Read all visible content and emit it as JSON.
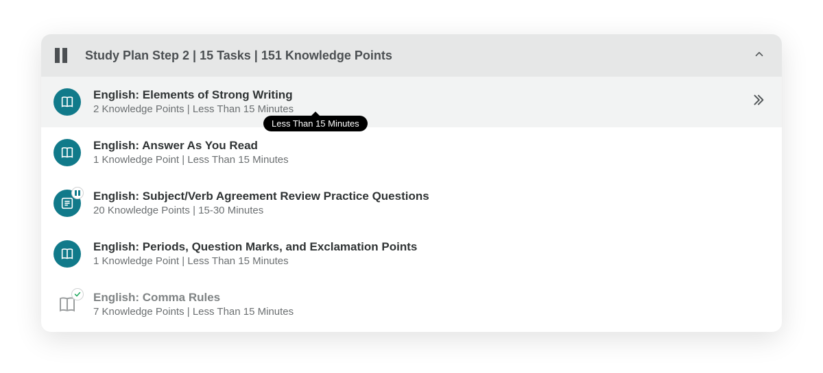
{
  "header": {
    "title": "Study Plan Step 2 | 15 Tasks | 151 Knowledge Points"
  },
  "tooltip": "Less Than 15 Minutes",
  "tasks": [
    {
      "title": "English: Elements of Strong Writing",
      "meta": "2 Knowledge Points | Less Than 15 Minutes",
      "icon": "book",
      "selected": true,
      "faded": false,
      "badge": null,
      "expand": true
    },
    {
      "title": "English: Answer As You Read",
      "meta": "1 Knowledge Point | Less Than 15 Minutes",
      "icon": "book",
      "selected": false,
      "faded": false,
      "badge": null,
      "expand": false
    },
    {
      "title": "English: Subject/Verb Agreement Review Practice Questions",
      "meta": "20 Knowledge Points | 15-30 Minutes",
      "icon": "list",
      "selected": false,
      "faded": false,
      "badge": "pause",
      "expand": false
    },
    {
      "title": "English: Periods, Question Marks, and Exclamation Points",
      "meta": "1 Knowledge Point | Less Than 15 Minutes",
      "icon": "book",
      "selected": false,
      "faded": false,
      "badge": null,
      "expand": false
    },
    {
      "title": "English: Comma Rules",
      "meta": "7 Knowledge Points | Less Than 15 Minutes",
      "icon": "book-light",
      "selected": false,
      "faded": true,
      "badge": "check",
      "expand": false
    }
  ]
}
